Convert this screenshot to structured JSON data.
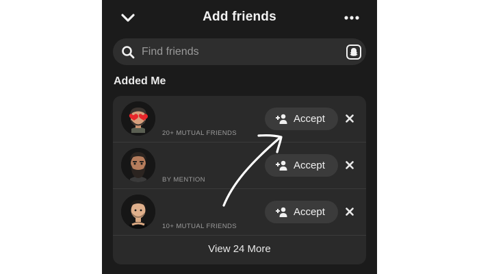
{
  "header": {
    "title": "Add friends",
    "back_icon": "chevron-down-icon",
    "more_icon": "more-dots-icon"
  },
  "search": {
    "placeholder": "Find friends",
    "value": "",
    "icon": "search-icon",
    "right_icon": "ghost-icon"
  },
  "section": {
    "title": "Added Me"
  },
  "requests": [
    {
      "subtitle": "20+ MUTUAL FRIENDS",
      "accept_label": "Accept",
      "avatar": "bitmoji-heart-eyes"
    },
    {
      "subtitle": "BY MENTION",
      "accept_label": "Accept",
      "avatar": "bitmoji-beard"
    },
    {
      "subtitle": "10+ MUTUAL FRIENDS",
      "accept_label": "Accept",
      "avatar": "bitmoji-tank-top"
    }
  ],
  "view_more": "View 24 More",
  "colors": {
    "background": "#1b1b1b",
    "card": "#2a2a2a",
    "button": "#3b3b3b",
    "text": "#f2f2f2",
    "muted": "#9c9c9c",
    "annotation_arrow": "#ffffff"
  }
}
